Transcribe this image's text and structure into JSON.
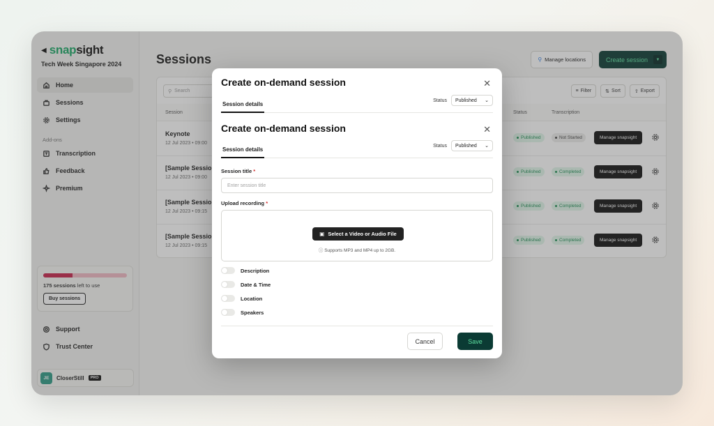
{
  "app": {
    "logo_part1": "snap",
    "logo_part2": "sight",
    "event": "Tech Week Singapore 2024"
  },
  "sidebar": {
    "items": [
      {
        "label": "Home",
        "icon": "home-icon"
      },
      {
        "label": "Sessions",
        "icon": "sessions-icon"
      },
      {
        "label": "Settings",
        "icon": "gear-icon"
      }
    ],
    "addons_label": "Add-ons",
    "addons": [
      {
        "label": "Transcription",
        "icon": "transcription-icon"
      },
      {
        "label": "Feedback",
        "icon": "thumbs-up-icon"
      },
      {
        "label": "Premium",
        "icon": "sparkle-icon"
      }
    ],
    "quota": {
      "count": "175 sessions",
      "suffix": " left to use",
      "used_fraction": 0.35,
      "button": "Buy sessions"
    },
    "bottom": [
      {
        "label": "Support",
        "icon": "support-icon"
      },
      {
        "label": "Trust Center",
        "icon": "shield-icon"
      }
    ],
    "user": {
      "initials": "JE",
      "name": "CloserStill",
      "badge": "PRO"
    }
  },
  "main": {
    "title": "Sessions",
    "manage_locations": "Manage locations",
    "create_session": "Create session",
    "search_placeholder": "Search",
    "tools": {
      "filter": "Filter",
      "sort": "Sort",
      "export": "Export"
    },
    "columns": {
      "session": "Session",
      "status": "Status",
      "transcription": "Transcription"
    },
    "rows": [
      {
        "title": "Keynote",
        "date": "12 Jul 2023 • 09:00",
        "status": "Published",
        "transcription": "Not Started",
        "action": "Manage snapsight"
      },
      {
        "title": "[Sample Session",
        "date": "12 Jul 2023 • 09:00",
        "status": "Published",
        "transcription": "Completed",
        "action": "Manage snapsight"
      },
      {
        "title": "[Sample Session",
        "date": "12 Jul 2023 • 09:15",
        "status": "Published",
        "transcription": "Completed",
        "action": "Manage snapsight"
      },
      {
        "title": "[Sample Session",
        "date": "12 Jul 2023 • 09:15",
        "status": "Published",
        "transcription": "Completed",
        "action": "Manage snapsight"
      }
    ]
  },
  "modal": {
    "title": "Create on-demand session",
    "tab": "Session details",
    "status_label": "Status",
    "status_value": "Published",
    "session_title_label": "Session title",
    "session_title_placeholder": "Enter session title",
    "upload_label": "Upload recording",
    "upload_button": "Select a Video or Audio File",
    "upload_note": "Supports MP3 and MP4 up to 2GB.",
    "toggles": [
      "Description",
      "Date & Time",
      "Location",
      "Speakers"
    ],
    "cancel": "Cancel",
    "save": "Save",
    "required_mark": "*"
  },
  "colors": {
    "brand_green": "#19a866",
    "primary_dark": "#0b3b34",
    "primary_text": "#5fe0a0",
    "quota_fill": "#c8244c"
  }
}
